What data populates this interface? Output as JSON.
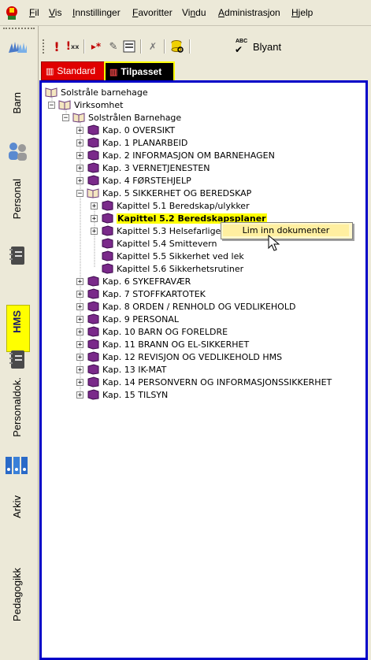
{
  "menubar": {
    "items": [
      "Fil",
      "Vis",
      "Innstillinger",
      "Favoritter",
      "Vindu",
      "Administrasjon",
      "Hjelp"
    ],
    "underlines": [
      "F",
      "V",
      "I",
      "F",
      "n",
      "A",
      "H"
    ]
  },
  "sidebar": {
    "tabs": [
      {
        "label": "Barn",
        "icon": "hands-icon"
      },
      {
        "label": "Personal",
        "icon": "people-icon"
      },
      {
        "label": "HMS",
        "icon": "notebook-icon"
      },
      {
        "label": "Personaldok.",
        "icon": "notebook-icon"
      },
      {
        "label": "Arkiv",
        "icon": "binders-icon"
      },
      {
        "label": "Pedagogikk",
        "icon": ""
      }
    ],
    "active": "HMS",
    "active_color": "#ffff00"
  },
  "toolbar": {
    "blyant_label": "Blyant",
    "abc_label": "ABC"
  },
  "tabs": {
    "standard": "Standard",
    "tilpasset": "Tilpasset",
    "active": "Tilpasset",
    "standard_color": "#e00000",
    "active_border_color": "#ffff00"
  },
  "tree": {
    "root": "Solstråle barnehage",
    "level1": "Virksomhet",
    "level2": "Solstrålen Barnehage",
    "chapters_top": [
      "Kap. 0  OVERSIKT",
      "Kap. 1   PLANARBEID",
      "Kap. 2   INFORMASJON OM BARNEHAGEN",
      "Kap. 3   VERNETJENESTEN",
      "Kap. 4   FØRSTEHJELP",
      "Kap. 5  SIKKERHET OG BEREDSKAP"
    ],
    "kap5_children": [
      "Kapittel 5.1 Beredskap/ulykker",
      "Kapittel 5.2 Beredskapsplaner",
      "Kapittel 5.3 Helsefarlige fo",
      "Kapittel 5.4 Smittevern",
      "Kapittel 5.5 Sikkerhet ved lek",
      "Kapittel 5.6 Sikkerhetsrutiner"
    ],
    "chapters_bottom": [
      "Kap. 6   SYKEFRAVÆR",
      "Kap. 7   STOFFKARTOTEK",
      "Kap. 8   ORDEN / RENHOLD OG VEDLIKEHOLD",
      "Kap. 9   PERSONAL",
      "Kap. 10 BARN OG FORELDRE",
      "Kap. 11 BRANN OG EL-SIKKERHET",
      "Kap. 12 REVISJON OG VEDLIKEHOLD HMS",
      "Kap. 13 IK-MAT",
      "Kap. 14  PERSONVERN OG INFORMASJONSSIKKERHET",
      "Kap. 15 TILSYN"
    ],
    "selected": "Kapittel 5.2 Beredskapsplaner",
    "book_color": "#7a2a8a"
  },
  "context_menu": {
    "items": [
      "Lim inn dokumenter"
    ]
  }
}
